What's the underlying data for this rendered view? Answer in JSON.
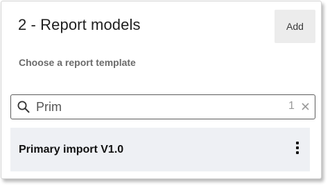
{
  "panel": {
    "title": "2 - Report models",
    "add_label": "Add",
    "subtitle": "Choose a report template"
  },
  "search": {
    "value": "Prim",
    "result_count": "1",
    "icon": "search-icon",
    "clear_icon": "close-icon"
  },
  "results": {
    "items": [
      {
        "label": "Primary import V1.0",
        "menu_icon": "more-vertical-icon"
      }
    ]
  },
  "colors": {
    "item_background": "#eef0f4",
    "button_background": "#ececec",
    "search_border": "#5c5c5c"
  }
}
